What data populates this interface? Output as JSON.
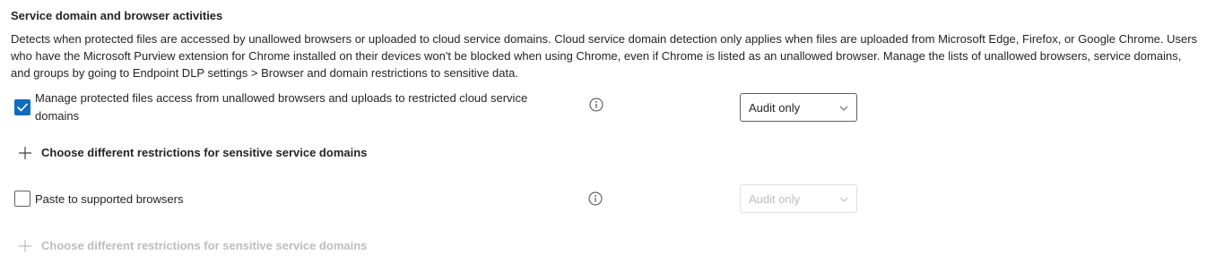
{
  "section": {
    "title": "Service domain and browser activities",
    "description": "Detects when protected files are accessed by unallowed browsers or uploaded to cloud service domains. Cloud service domain detection only applies when files are uploaded from Microsoft Edge, Firefox, or Google Chrome. Users who have the Microsoft Purview extension for Chrome installed on their devices won't be blocked when using Chrome, even if Chrome is listed as an unallowed browser. Manage the lists of unallowed browsers, service domains, and groups by going to Endpoint DLP settings > Browser and domain restrictions to sensitive data."
  },
  "settings": [
    {
      "label": "Manage protected files access from unallowed browsers and uploads to restricted cloud service domains",
      "checked": true,
      "enabled": true,
      "action": "Audit only",
      "icon": "info-icon",
      "expand_label": "Choose different restrictions for sensitive service domains"
    },
    {
      "label": "Paste to supported browsers",
      "checked": false,
      "enabled": false,
      "action": "Audit only",
      "icon": "info-icon",
      "expand_label": "Choose different restrictions for sensitive service domains"
    }
  ],
  "colors": {
    "accent": "#0f6cbd",
    "text": "#242424",
    "disabled_text": "#bdbdbd",
    "disabled_border": "#e0e0e0"
  }
}
